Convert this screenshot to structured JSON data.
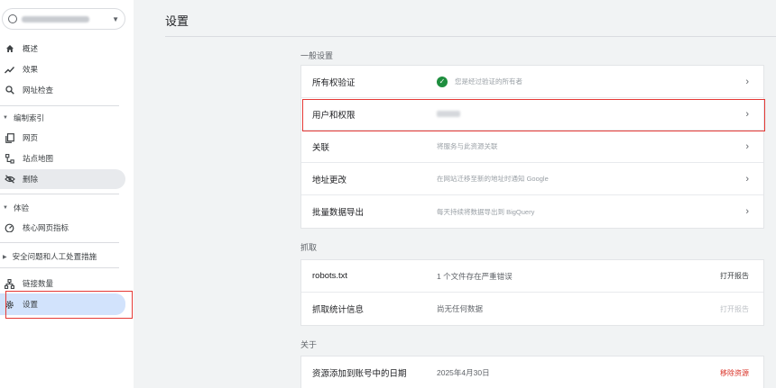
{
  "sidebar": {
    "property_placeholder_icon": "globe-icon",
    "items": [
      {
        "label": "概述",
        "icon": "home-icon"
      },
      {
        "label": "效果",
        "icon": "trending-up-icon"
      },
      {
        "label": "网址检查",
        "icon": "search-icon"
      }
    ],
    "index_section": "编制索引",
    "index_items": [
      {
        "label": "网页",
        "icon": "pages-icon"
      },
      {
        "label": "站点地图",
        "icon": "sitemap-icon"
      },
      {
        "label": "删除",
        "icon": "eye-off-icon"
      }
    ],
    "experience_section": "体验",
    "experience_items": [
      {
        "label": "核心网页指标",
        "icon": "gauge-icon"
      }
    ],
    "security_section": "安全问题和人工处置措施",
    "links_label": "链接数量",
    "settings_label": "设置"
  },
  "main": {
    "title": "设置",
    "general_label": "一般设置",
    "general_rows": [
      {
        "label": "所有权验证",
        "desc": "您是经过验证的所有者"
      },
      {
        "label": "用户和权限",
        "desc": ""
      },
      {
        "label": "关联",
        "desc": "将服务与此资源关联"
      },
      {
        "label": "地址更改",
        "desc": "在网站迁移至新的地址时通知 Google"
      },
      {
        "label": "批量数据导出",
        "desc": "每天持续将数据导出到 BigQuery"
      }
    ],
    "crawl_label": "抓取",
    "crawl_rows": [
      {
        "label": "robots.txt",
        "desc": "1 个文件存在严重错误",
        "action": "打开报告"
      },
      {
        "label": "抓取统计信息",
        "desc": "尚无任何数据",
        "action": "打开报告"
      }
    ],
    "about_label": "关于",
    "about_rows": [
      {
        "label": "资源添加到账号中的日期",
        "desc": "2025年4月30日",
        "action": "移除资源"
      }
    ]
  },
  "colors": {
    "accent": "#1a73e8",
    "active_nav": "#d2e3fc",
    "success": "#1e8e3e",
    "danger": "#d93025",
    "highlight": "#e53935"
  }
}
